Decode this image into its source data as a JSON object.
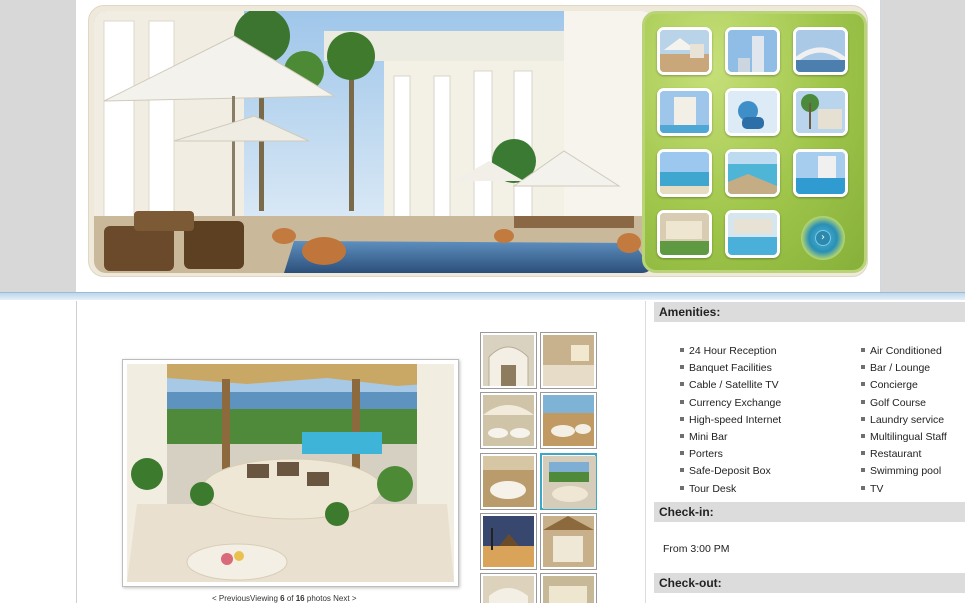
{
  "hero": {
    "thumbnails": [
      {
        "name": "thumb-pool-umbrellas"
      },
      {
        "name": "thumb-tower-building"
      },
      {
        "name": "thumb-bridge-waterfront"
      },
      {
        "name": "thumb-hotel-exterior"
      },
      {
        "name": "thumb-swimmer"
      },
      {
        "name": "thumb-palm-resort"
      },
      {
        "name": "thumb-beach-sea"
      },
      {
        "name": "thumb-coastline-rocks"
      },
      {
        "name": "thumb-pool-highrise"
      },
      {
        "name": "thumb-garden-villas"
      },
      {
        "name": "thumb-pool-deck"
      }
    ],
    "next_arrow_icon": "chevron-right-icon",
    "next_arrow_glyph": "›"
  },
  "gallery": {
    "thumbnails": [
      {
        "name": "gallery-thumb-lobby-arches"
      },
      {
        "name": "gallery-thumb-bedroom"
      },
      {
        "name": "gallery-thumb-dining-hall"
      },
      {
        "name": "gallery-thumb-terrace-dining"
      },
      {
        "name": "gallery-thumb-banquet-tables"
      },
      {
        "name": "gallery-thumb-terrace-view"
      },
      {
        "name": "gallery-thumb-sunset-palapa"
      },
      {
        "name": "gallery-thumb-open-lobby"
      },
      {
        "name": "gallery-thumb-arch-walkway"
      },
      {
        "name": "gallery-thumb-resort-room"
      }
    ],
    "selected_index": 5,
    "pager": {
      "prev_label": "< Previous",
      "viewing_label": "Viewing",
      "current": "6",
      "of_label": "of",
      "total": "16",
      "photos_label": "photos",
      "next_label": "Next >"
    }
  },
  "amenities": {
    "heading": "Amenities:",
    "left": [
      "24 Hour Reception",
      "Banquet Facilities",
      "Cable / Satellite TV",
      "Currency Exchange",
      "High-speed Internet",
      "Mini Bar",
      "Porters",
      "Safe-Deposit Box",
      "Tour Desk"
    ],
    "right": [
      "Air Conditioned",
      "Bar / Lounge",
      "Concierge",
      "Golf Course",
      "Laundry service",
      "Multilingual Staff",
      "Restaurant",
      "Swimming pool",
      "TV"
    ]
  },
  "checkin": {
    "heading": "Check-in:",
    "time": "From 3:00 PM"
  },
  "checkout": {
    "heading": "Check-out:"
  },
  "colors": {
    "panel_green": "#9fc54a",
    "arrow_blue": "#2a8fb5",
    "section_header_bg": "#dcdcdc",
    "selected_border": "#3fa7c6"
  }
}
